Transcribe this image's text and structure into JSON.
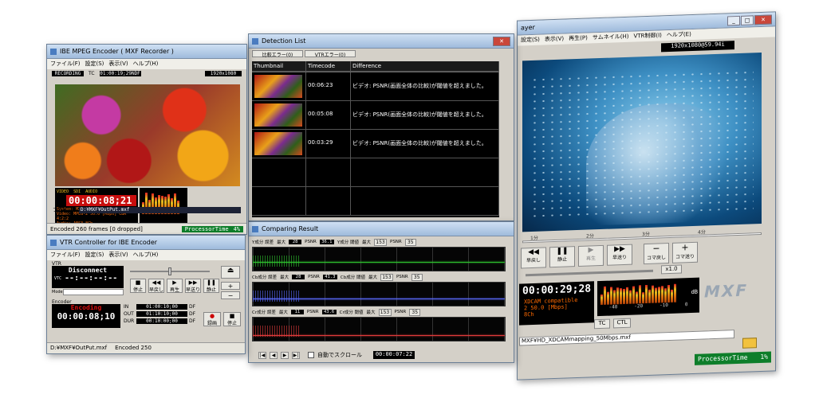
{
  "player": {
    "title": "ayer",
    "menu": [
      "設定(S)",
      "表示(V)",
      "再生(P)",
      "サムネイル(H)",
      "VTR制御(I)",
      "ヘルプ(E)"
    ],
    "resolution": "1920x1080@59.94i",
    "time_ticks": [
      "1分",
      "2分",
      "3分",
      "4分"
    ],
    "buttons": [
      "早戻し",
      "静止",
      "再生",
      "早送り",
      "コマ戻し",
      "コマ送り"
    ],
    "speed": "x1.0",
    "timecode": "00:00:29;28",
    "format_line1": "XDCAM compatible",
    "format_line2": "2 50.0 [Mbps]",
    "format_line3": "8Ch",
    "db_label": "dB",
    "meter_ticks": [
      "-40",
      "-20",
      "-10",
      "0"
    ],
    "tc_button": "TC",
    "ctl_button": "CTL",
    "file_path": "MXF¥HD_XDCAMmapping_50Mbps.mxf",
    "processor": "ProcessorTime",
    "processor_value": "1%",
    "logo": "MXF"
  },
  "encoder": {
    "title": "IBE MPEG Encoder ( MXF Recorder )",
    "menu": [
      "ファイル(F)",
      "設定(S)",
      "表示(V)",
      "ヘルプ(H)"
    ],
    "recording": "RECORDING",
    "tc_label": "TC",
    "tc": "01:00:19;29NDF",
    "resolution": "1920x1080",
    "meter_header": [
      "VIDEO",
      "SDI",
      "AUDIO"
    ],
    "rec_tc": "00:00:08;21",
    "sys_line1": "System: MXF XDCAM mapping",
    "sys_line2": "Video: MPEG-2 50.0 [Mbps] CBR 4:2:2",
    "sys_line3": "Audio: AES3 8Ch",
    "file_label": "ファイル名",
    "file_value": "D:¥MXF¥OutPut.mxf",
    "status": "Encoded 260 frames [0 dropped]",
    "processor": "ProcessorTime",
    "processor_value": "4%"
  },
  "vtr": {
    "title": "VTR Controller for IBE Encoder",
    "menu": [
      "ファイル(F)",
      "設定(S)",
      "表示(V)",
      "ヘルプ(H)"
    ],
    "vtr_label": "VTR",
    "disconnect": "Disconnect",
    "vtc": "VTC",
    "vtc_tc": "--:--:--:--",
    "mode_label": "Mode",
    "transport": [
      "停止",
      "早戻し",
      "再生",
      "早送り",
      "静止"
    ],
    "encoder_label": "Encoder",
    "encoding": "Encoding",
    "enc_tc": "00:00:08;10",
    "in_label": "IN",
    "out_label": "OUT",
    "dur_label": "DUR",
    "in_tc": "01:00:10;00",
    "out_tc": "01:10:10;00",
    "dur_tc": "00:10:00;00",
    "df_tag": "DF",
    "rec_button": "録画",
    "pause_button": "停止",
    "status_path": "D:¥MXF¥OutPut.mxf",
    "status_encoded": "Encoded 250"
  },
  "detection": {
    "title": "Detection List",
    "tabs": [
      "比較エラー(0)",
      "VTRエラー(0)"
    ],
    "headers": [
      "Thumbnail",
      "Timecode",
      "Difference"
    ],
    "rows": [
      {
        "timecode": "00:06:23",
        "difference": "ビデオ: PSNR(画面全体の比較)が閾値を超えました。"
      },
      {
        "timecode": "00:05:08",
        "difference": "ビデオ: PSNR(画面全体の比較)が閾値を超えました。"
      },
      {
        "timecode": "00:03:29",
        "difference": "ビデオ: PSNR(画面全体の比較)が閾値を超えました。"
      }
    ]
  },
  "comparing": {
    "title": "Comparing Result",
    "panels": [
      {
        "label": "Y成分 誤差",
        "max_label": "最大",
        "max": "28",
        "psnr_label": "PSNR",
        "psnr": "36.1",
        "thr_label": "Y成分 閾値",
        "thr_max": "153",
        "thr_psnr": "35"
      },
      {
        "label": "Cb成分 誤差",
        "max_label": "最大",
        "max": "28",
        "psnr_label": "PSNR",
        "psnr": "41.3",
        "thr_label": "Cb成分 閾値",
        "thr_max": "153",
        "thr_psnr": "35"
      },
      {
        "label": "Cr成分 誤差",
        "max_label": "最大",
        "max": "11",
        "psnr_label": "PSNR",
        "psnr": "43.6",
        "thr_label": "Cr成分 閾値",
        "thr_max": "153",
        "thr_psnr": "35"
      }
    ],
    "autoscroll": "自動でスクロール",
    "time": "00:00:07:22"
  },
  "colors": {
    "titlebar": "#9fbbdc",
    "window": "#d4d0c8",
    "red_tc": "#e01010",
    "status_green": "#0e7e2a"
  }
}
